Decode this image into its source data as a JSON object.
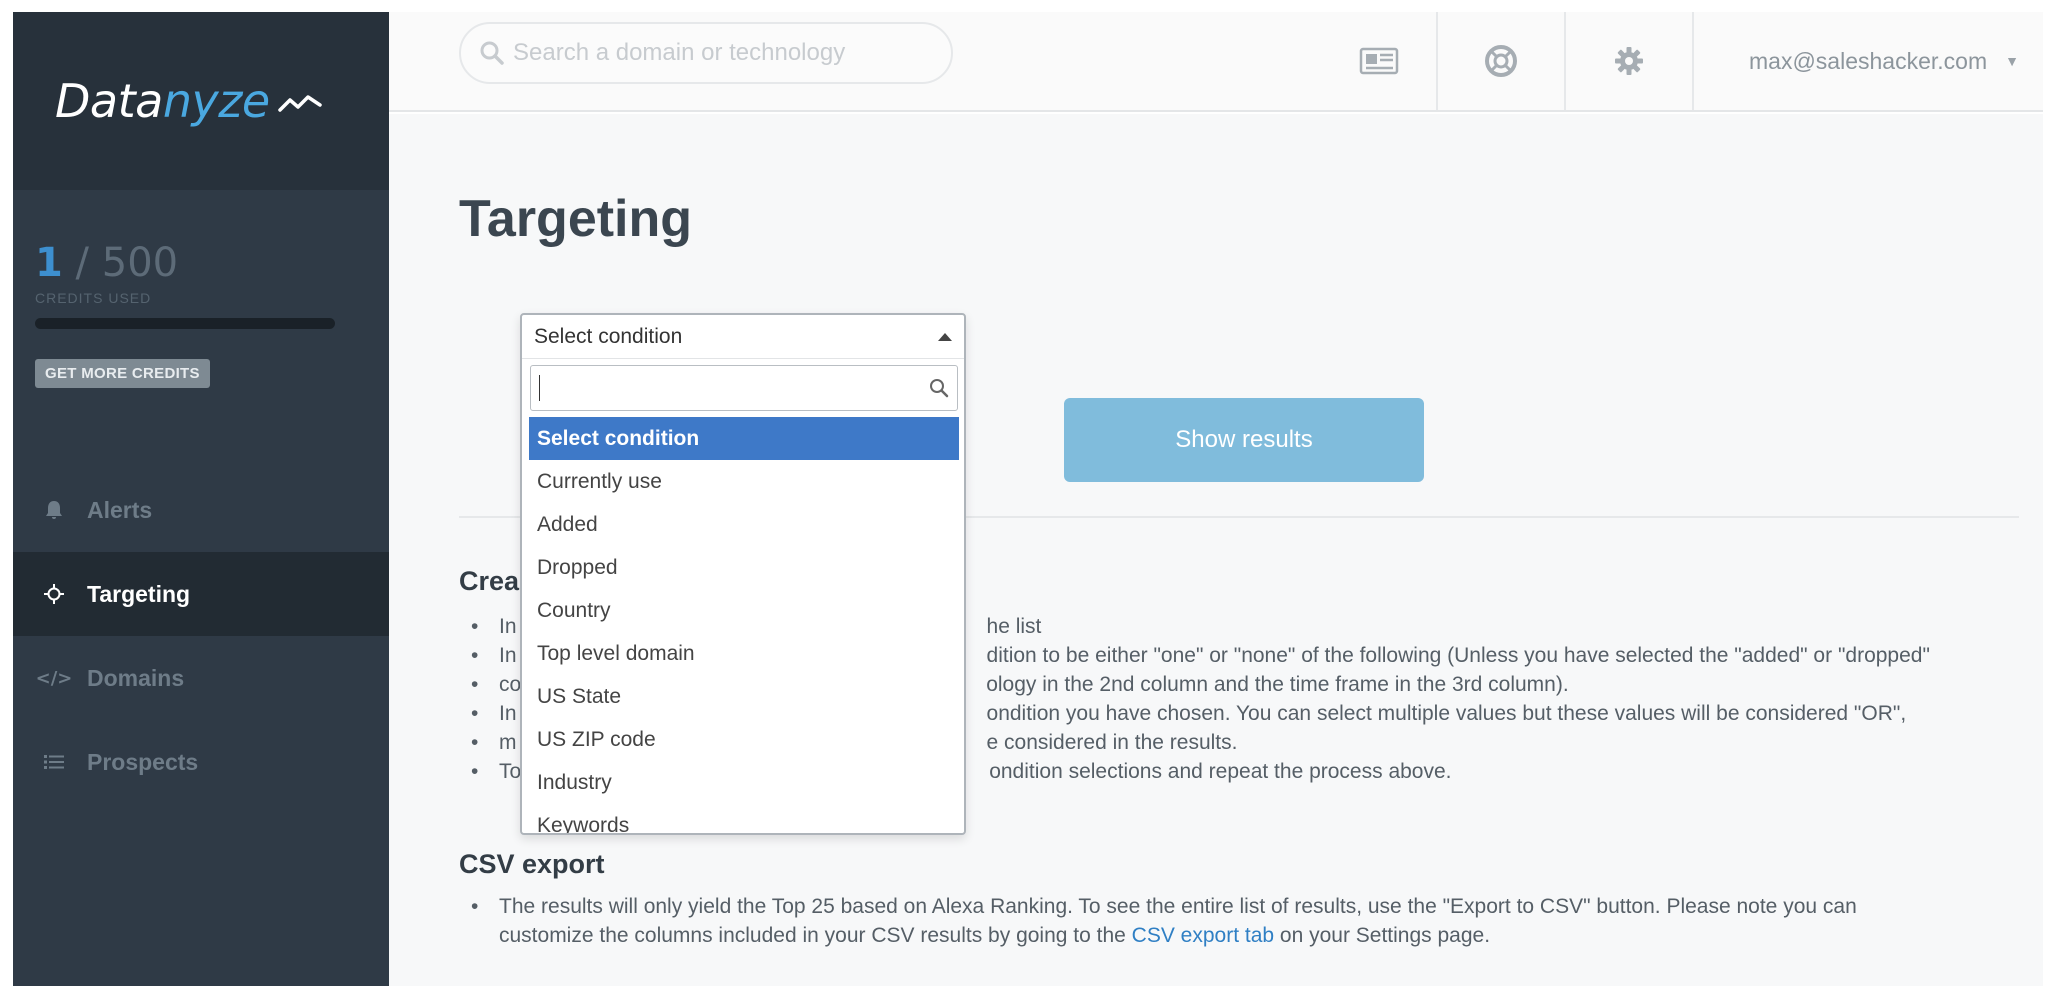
{
  "brand": {
    "name_part1": "Data",
    "name_part2": "nyze"
  },
  "credits": {
    "used": "1",
    "separator": " / ",
    "total": "500",
    "label": "CREDITS USED",
    "get_more_label": "GET MORE CREDITS"
  },
  "sidebar": {
    "items": [
      {
        "label": "Alerts",
        "icon": "bell-icon",
        "active": false
      },
      {
        "label": "Targeting",
        "icon": "crosshair-icon",
        "active": true
      },
      {
        "label": "Domains",
        "icon": "code-icon",
        "active": false
      },
      {
        "label": "Prospects",
        "icon": "list-icon",
        "active": false
      }
    ]
  },
  "topbar": {
    "search_placeholder": "Search a domain or technology",
    "user_email": "max@saleshacker.com"
  },
  "main": {
    "title": "Targeting",
    "show_results_label": "Show results"
  },
  "dropdown": {
    "selected_value": "Select condition",
    "options": [
      "Select condition",
      "Currently use",
      "Added",
      "Dropped",
      "Country",
      "Top level domain",
      "US State",
      "US ZIP code",
      "Industry",
      "Keywords"
    ]
  },
  "help": {
    "section1_heading": "Crea",
    "section1_lines": [
      {
        "a": "In",
        "b": "he list"
      },
      {
        "a": "In",
        "b": "dition to be either \"one\" or \"none\" of the following (Unless you have selected the \"added\" or \"dropped\""
      },
      {
        "a": "co",
        "b": "ology in the 2nd column and the time frame in the 3rd column)."
      },
      {
        "a": "In",
        "b": "ondition you have chosen. You can select multiple values but these values will be considered \"OR\","
      },
      {
        "a": "m",
        "b": "e considered in the results."
      },
      {
        "a": "To",
        "b": "ondition selections and repeat the process above."
      }
    ],
    "section2_heading": "CSV export",
    "section2_line1": "The results will only yield the Top 25 based on Alexa Ranking. To see the entire list of results, use the \"Export to CSV\" button. Please note you can",
    "section2_line2_pre": "customize the columns included in your CSV results by going to the ",
    "section2_link": "CSV export tab",
    "section2_line2_post": " on your Settings page."
  },
  "colors": {
    "sidebar_bg": "#2f3a46",
    "accent_blue": "#3e79c8",
    "button_blue": "#80bcdc"
  }
}
